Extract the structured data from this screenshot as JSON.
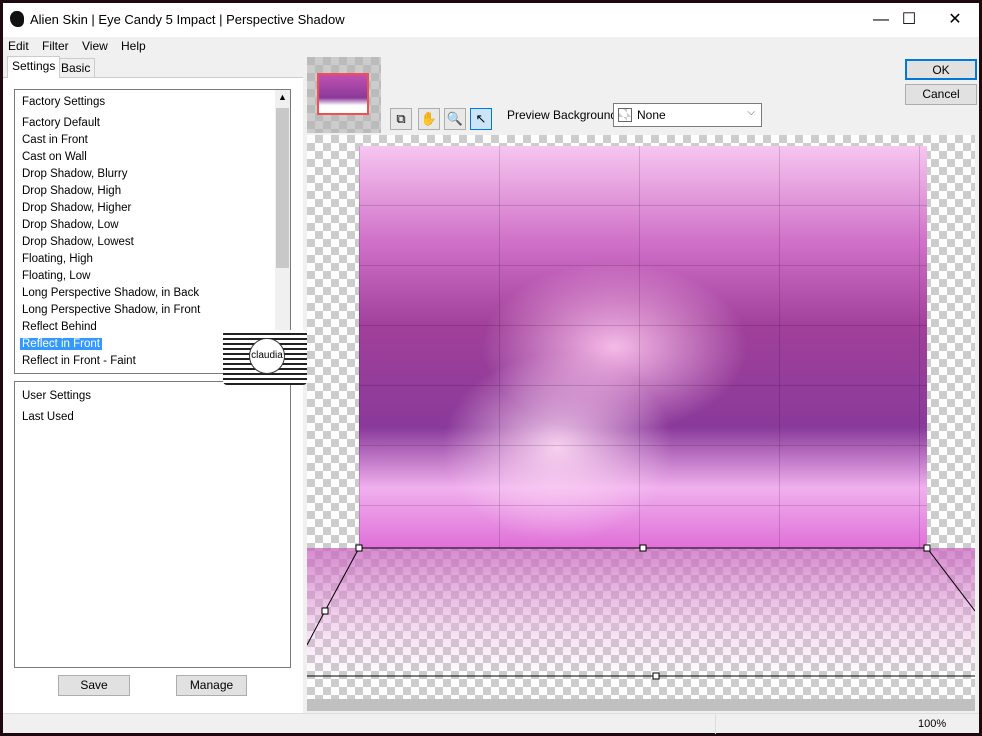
{
  "window": {
    "title": "Alien Skin | Eye Candy 5 Impact | Perspective Shadow",
    "minimize": "—",
    "maximize": "☐",
    "close": "✕"
  },
  "menu": [
    "Edit",
    "Filter",
    "View",
    "Help"
  ],
  "tabs": [
    {
      "label": "Settings",
      "active": true
    },
    {
      "label": "Basic",
      "active": false
    }
  ],
  "factory": {
    "header": "Factory Settings",
    "items": [
      "Factory Default",
      "Cast in Front",
      "Cast on Wall",
      "Drop Shadow, Blurry",
      "Drop Shadow, High",
      "Drop Shadow, Higher",
      "Drop Shadow, Low",
      "Drop Shadow, Lowest",
      "Floating, High",
      "Floating, Low",
      "Long Perspective Shadow, in Back",
      "Long Perspective Shadow, in Front",
      "Reflect Behind",
      "Reflect in Front",
      "Reflect in Front - Faint"
    ],
    "selected": "Reflect in Front"
  },
  "user": {
    "header": "User Settings",
    "items": [
      "Last Used"
    ]
  },
  "buttons": {
    "save": "Save",
    "manage": "Manage",
    "ok": "OK",
    "cancel": "Cancel"
  },
  "toolbar": {
    "tools": [
      "preview-toggle-icon",
      "hand-icon",
      "zoom-icon",
      "pointer-icon"
    ],
    "active": "pointer-icon"
  },
  "preview_background": {
    "label": "Preview Background:",
    "value": "None"
  },
  "watermark": "claudia",
  "status": {
    "zoom": "100%"
  },
  "colors": {
    "selection": "#3399ff",
    "ok_border": "#0078d7"
  }
}
